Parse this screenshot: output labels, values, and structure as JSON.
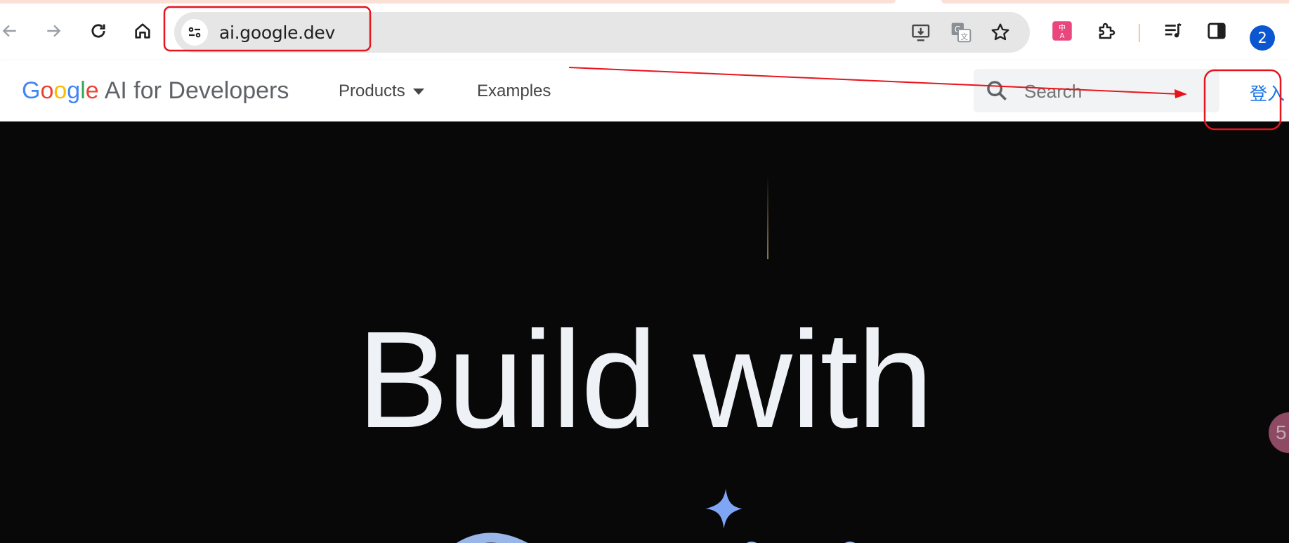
{
  "browser": {
    "url": "ai.google.dev",
    "profile_number": "2",
    "nav_icons": [
      "back-arrow-icon",
      "forward-arrow-icon",
      "reload-icon",
      "home-icon"
    ],
    "omnibox_icons": [
      "site-info-icon",
      "install-app-icon",
      "translate-icon",
      "bookmark-star-icon"
    ],
    "toolbar_icons": [
      "translate-extension-icon",
      "extensions-puzzle-icon",
      "media-queue-icon",
      "side-panel-icon"
    ]
  },
  "site": {
    "logo": {
      "letters": [
        "G",
        "o",
        "o",
        "g",
        "l",
        "e"
      ],
      "suffix": "AI for Developers"
    },
    "nav": {
      "products": "Products",
      "examples": "Examples"
    },
    "search_placeholder": "Search",
    "signin": "登入"
  },
  "hero": {
    "title": "Build with",
    "badge_text": "5"
  },
  "colors": {
    "google_blue": "#4285f4",
    "google_red": "#ea4335",
    "google_yellow": "#fbbc05",
    "google_green": "#34a853",
    "link_blue": "#1a73e8",
    "annotation_red": "#e8141c",
    "hero_bg": "#080808",
    "profile_blue": "#0b57d0"
  }
}
